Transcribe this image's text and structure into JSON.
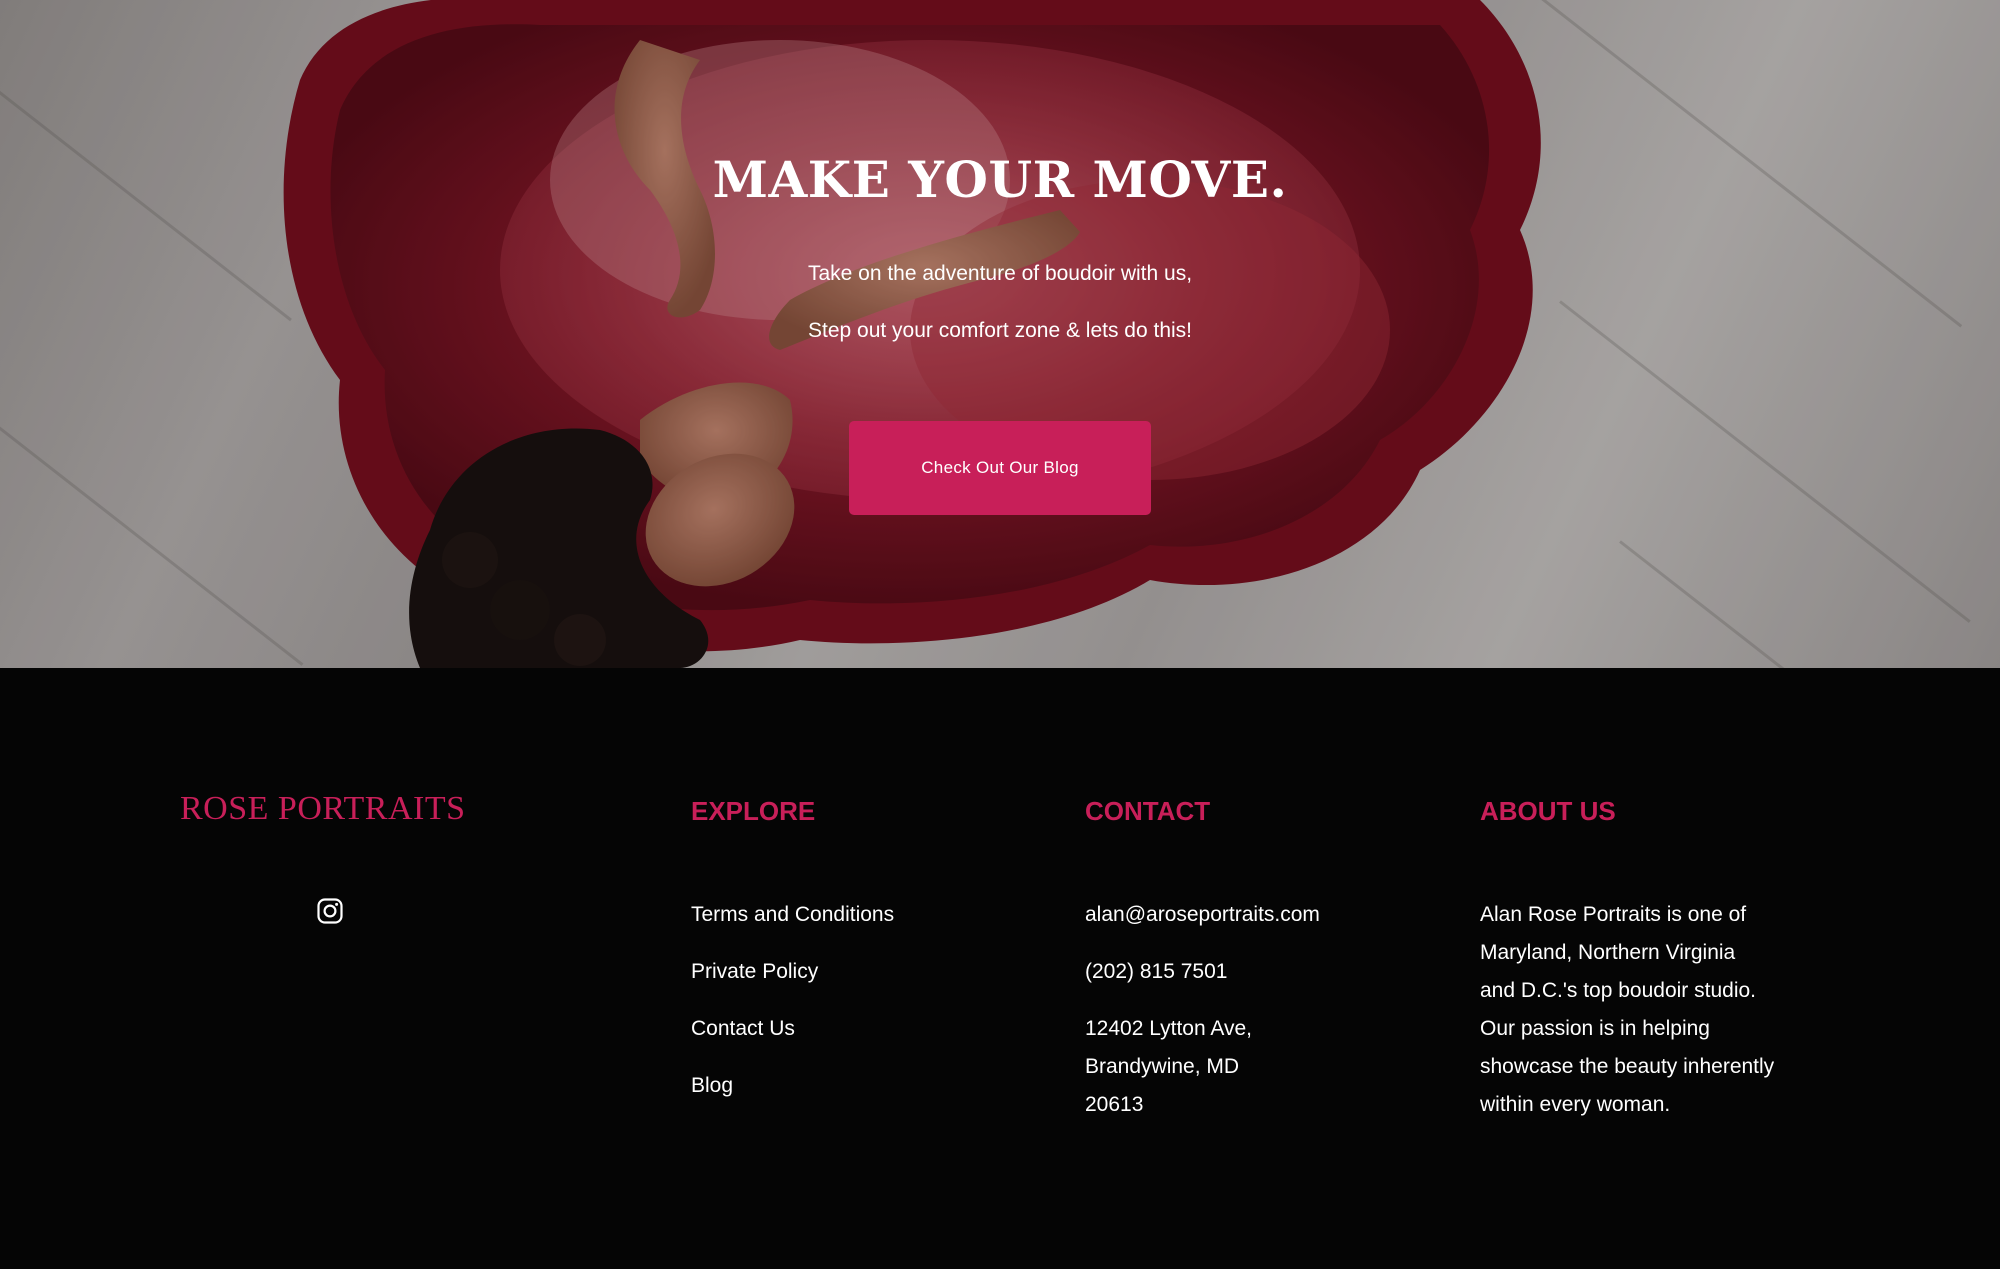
{
  "hero": {
    "title": "MAKE YOUR MOVE.",
    "line1": "Take on the adventure of boudoir with us,",
    "line2": "Step out your comfort zone & lets do this!",
    "button_label": "Check Out Our Blog"
  },
  "footer": {
    "brand": "ROSE PORTRAITS",
    "social_icon": "instagram-icon",
    "explore": {
      "heading": "EXPLORE",
      "links": [
        "Terms and Conditions",
        "Private Policy",
        "Contact Us",
        "Blog"
      ]
    },
    "contact": {
      "heading": "CONTACT",
      "email": "alan@aroseportraits.com",
      "phone": "(202) 815 7501",
      "address_line1": "12402 Lytton Ave,",
      "address_line2": "Brandywine, MD",
      "address_line3": "20613"
    },
    "about": {
      "heading": "ABOUT US",
      "lines": [
        "Alan Rose Portraits is one of",
        "Maryland, Northern Virginia",
        "and D.C.'s top boudoir studio.",
        "Our passion is in helping",
        "showcase the beauty inherently",
        "within every woman."
      ]
    }
  },
  "colors": {
    "accent": "#c81f59",
    "footer_bg": "#050505",
    "text": "#ffffff"
  }
}
